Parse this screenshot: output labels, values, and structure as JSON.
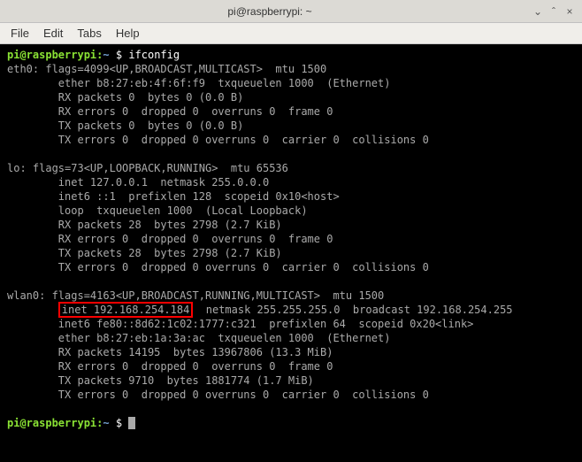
{
  "titlebar": {
    "title": "pi@raspberrypi: ~",
    "minimize": "⌄",
    "maximize": "ˆ",
    "close": "×"
  },
  "menubar": {
    "file": "File",
    "edit": "Edit",
    "tabs": "Tabs",
    "help": "Help"
  },
  "prompt": {
    "user": "pi@raspberrypi",
    "colon": ":",
    "path": "~",
    "dollar": " $ ",
    "command": "ifconfig"
  },
  "output": {
    "eth0_head": "eth0: flags=4099<UP,BROADCAST,MULTICAST>  mtu 1500",
    "eth0_ether": "        ether b8:27:eb:4f:6f:f9  txqueuelen 1000  (Ethernet)",
    "eth0_rx1": "        RX packets 0  bytes 0 (0.0 B)",
    "eth0_rx2": "        RX errors 0  dropped 0  overruns 0  frame 0",
    "eth0_tx1": "        TX packets 0  bytes 0 (0.0 B)",
    "eth0_tx2": "        TX errors 0  dropped 0 overruns 0  carrier 0  collisions 0",
    "blank": " ",
    "lo_head": "lo: flags=73<UP,LOOPBACK,RUNNING>  mtu 65536",
    "lo_inet": "        inet 127.0.0.1  netmask 255.0.0.0",
    "lo_inet6": "        inet6 ::1  prefixlen 128  scopeid 0x10<host>",
    "lo_loop": "        loop  txqueuelen 1000  (Local Loopback)",
    "lo_rx1": "        RX packets 28  bytes 2798 (2.7 KiB)",
    "lo_rx2": "        RX errors 0  dropped 0  overruns 0  frame 0",
    "lo_tx1": "        TX packets 28  bytes 2798 (2.7 KiB)",
    "lo_tx2": "        TX errors 0  dropped 0 overruns 0  carrier 0  collisions 0",
    "wlan0_head": "wlan0: flags=4163<UP,BROADCAST,RUNNING,MULTICAST>  mtu 1500",
    "wlan0_inet_pre": "        ",
    "wlan0_inet_hl": "inet 192.168.254.184",
    "wlan0_inet_post": "  netmask 255.255.255.0  broadcast 192.168.254.255",
    "wlan0_inet6": "        inet6 fe80::8d62:1c02:1777:c321  prefixlen 64  scopeid 0x20<link>",
    "wlan0_ether": "        ether b8:27:eb:1a:3a:ac  txqueuelen 1000  (Ethernet)",
    "wlan0_rx1": "        RX packets 14195  bytes 13967806 (13.3 MiB)",
    "wlan0_rx2": "        RX errors 0  dropped 0  overruns 0  frame 0",
    "wlan0_tx1": "        TX packets 9710  bytes 1881774 (1.7 MiB)",
    "wlan0_tx2": "        TX errors 0  dropped 0 overruns 0  carrier 0  collisions 0"
  }
}
